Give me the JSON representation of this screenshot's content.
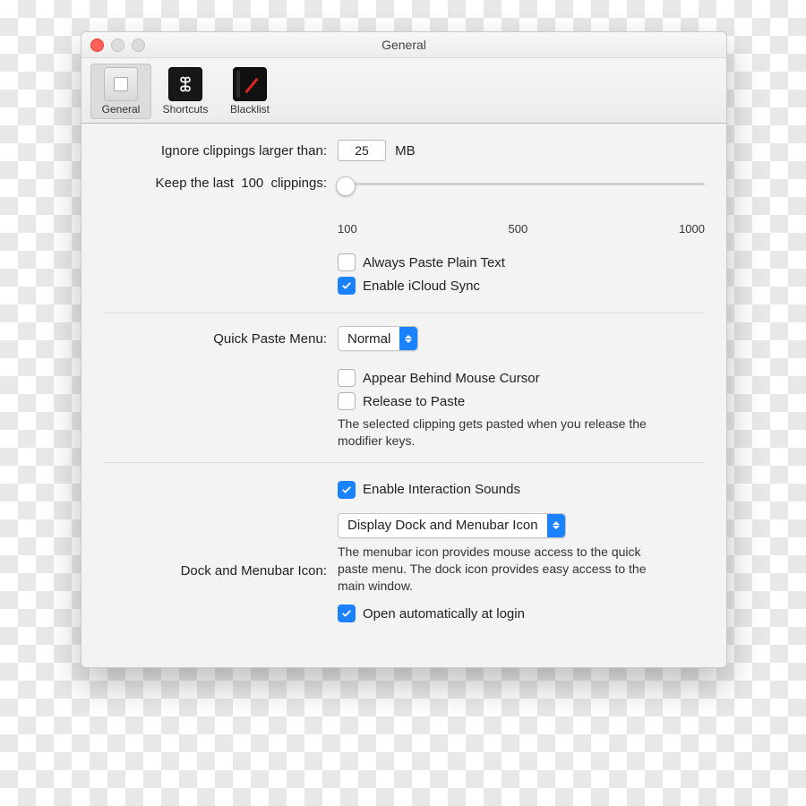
{
  "window": {
    "title": "General"
  },
  "toolbar": {
    "general": "General",
    "shortcuts": "Shortcuts",
    "blacklist": "Blacklist",
    "selected": "general"
  },
  "clip": {
    "ignore_label": "Ignore clippings larger than:",
    "ignore_value": "25",
    "ignore_unit": "MB",
    "keep_label_a": "Keep the last",
    "keep_value": "100",
    "keep_label_b": "clippings:",
    "slider": {
      "min": "100",
      "mid": "500",
      "max": "1000"
    },
    "always_plain": "Always Paste Plain Text",
    "icloud": "Enable iCloud Sync"
  },
  "quick": {
    "label": "Quick Paste Menu:",
    "value": "Normal",
    "behind": "Appear Behind Mouse Cursor",
    "release": "Release to Paste",
    "release_help": "The selected clipping gets pasted when you release the modifier keys."
  },
  "dock": {
    "sounds": "Enable Interaction Sounds",
    "label": "Dock and Menubar Icon:",
    "value": "Display Dock and Menubar Icon",
    "help": "The menubar icon provides mouse access to the quick paste menu. The dock icon provides easy access to the main window.",
    "login": "Open automatically at login"
  }
}
